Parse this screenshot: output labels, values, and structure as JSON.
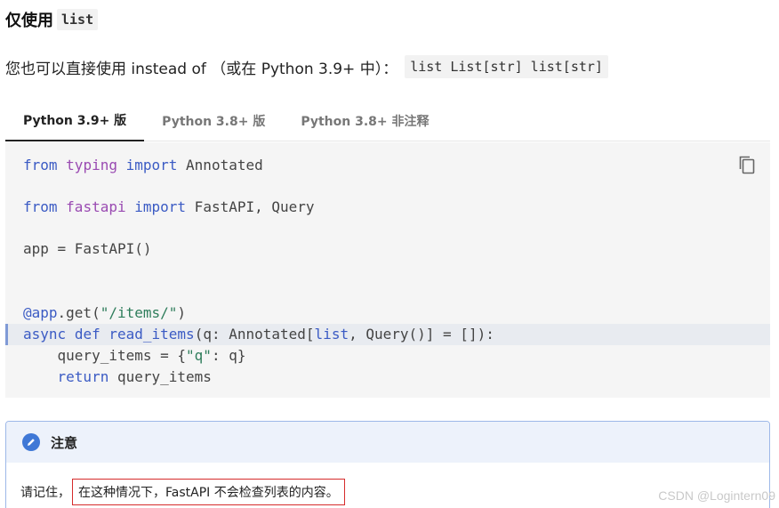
{
  "heading": {
    "prefix": "仅使用",
    "code": "list"
  },
  "paragraph": {
    "text": "您也可以直接使用 instead of （或在 Python 3.9+ 中）：",
    "code": "list List[str] list[str]"
  },
  "tabs": [
    {
      "label": "Python 3.9+ 版",
      "active": true
    },
    {
      "label": "Python 3.8+ 版",
      "active": false
    },
    {
      "label": "Python 3.8+ 非注释",
      "active": false
    }
  ],
  "code": {
    "copy_icon": "copy-icon",
    "tokens": {
      "from": "from",
      "typing": "typing",
      "import": "import",
      "annotated": " Annotated",
      "fastapi": "fastapi",
      "fastapi_rest": " FastAPI, Query",
      "app_line": "app = FastAPI()",
      "decorator_at": "@app",
      "decorator_get": ".get(",
      "decorator_path": "\"/items/\"",
      "decorator_close": ")",
      "async": "async",
      "def": "def",
      "fn_name": "read_items",
      "sig_a": "(q: Annotated[",
      "sig_list": "list",
      "sig_b": ", Query()] = []):",
      "body1_a": "    query_items = {",
      "body1_q": "\"q\"",
      "body1_b": ": q}",
      "return": "return",
      "return_rest": " query_items"
    }
  },
  "note": {
    "icon": "pencil-icon",
    "title": "注意",
    "prefix": "请记住，",
    "highlight": "在这种情况下，FastAPI 不会检查列表的内容。"
  },
  "watermark": "CSDN @Logintern09",
  "colors": {
    "keyword": "#3b5bc4",
    "module": "#9a4bb2",
    "string": "#2e7d5b",
    "note_accent": "#3f78d6",
    "highlight_box": "#d62b2b"
  }
}
